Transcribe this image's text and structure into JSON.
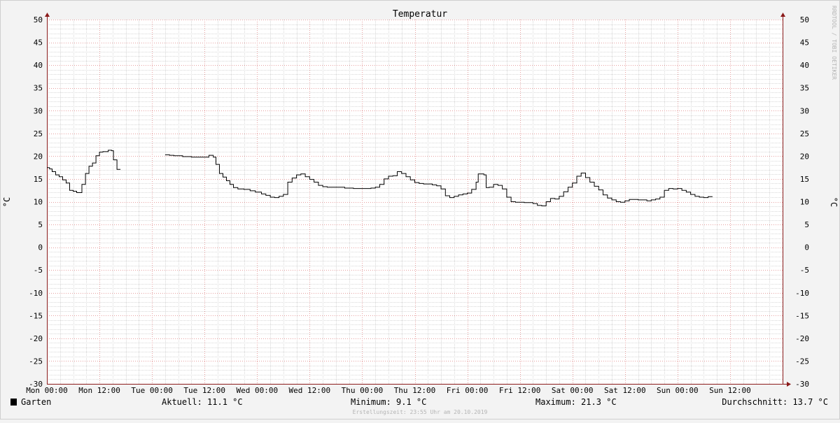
{
  "colors": {
    "background": "#f3f3f3",
    "canvas": "#ffffff",
    "grid_minor": "#d8d8d8",
    "grid_major": "#e6a0a0",
    "axis": "#8b1a1a",
    "line": "#000000",
    "text": "#000000",
    "watermark": "#b5b5b5"
  },
  "watermark": {
    "side_text": "RRDTOOL / TOBI OETIKER",
    "footer_text": "Erstellungszeit: 23:55 Uhr am 20.10.2019"
  },
  "legend": {
    "swatch_color": "#000000",
    "series_label": "Garten",
    "current": "Aktuell: 11.1 °C",
    "minimum": "Minimum: 9.1 °C",
    "maximum": "Maximum: 21.3 °C",
    "average": "Durchschnitt: 13.7 °C"
  },
  "chart_data": {
    "type": "line",
    "title": "Temperatur",
    "ylabel": "°C",
    "ylim": [
      -30,
      50
    ],
    "yticks": [
      50,
      45,
      40,
      35,
      30,
      25,
      20,
      15,
      10,
      5,
      0,
      -5,
      -10,
      -15,
      -20,
      -25,
      -30
    ],
    "x_unit": "hours since Mon 00:00",
    "xlim": [
      0,
      168
    ],
    "xticks": [
      {
        "x": 0,
        "label": "Mon 00:00"
      },
      {
        "x": 12,
        "label": "Mon 12:00"
      },
      {
        "x": 24,
        "label": "Tue 00:00"
      },
      {
        "x": 36,
        "label": "Tue 12:00"
      },
      {
        "x": 48,
        "label": "Wed 00:00"
      },
      {
        "x": 60,
        "label": "Wed 12:00"
      },
      {
        "x": 72,
        "label": "Thu 00:00"
      },
      {
        "x": 84,
        "label": "Thu 12:00"
      },
      {
        "x": 96,
        "label": "Fri 00:00"
      },
      {
        "x": 108,
        "label": "Fri 12:00"
      },
      {
        "x": 120,
        "label": "Sat 00:00"
      },
      {
        "x": 132,
        "label": "Sat 12:00"
      },
      {
        "x": 144,
        "label": "Sun 00:00"
      },
      {
        "x": 156,
        "label": "Sun 12:00"
      }
    ],
    "grid": true,
    "series": [
      {
        "name": "Garten",
        "segments": [
          [
            [
              0,
              17.5
            ],
            [
              0.6,
              17.2
            ],
            [
              1.2,
              16.6
            ],
            [
              2,
              15.9
            ],
            [
              2.8,
              15.5
            ],
            [
              3.6,
              14.8
            ],
            [
              4.4,
              14.1
            ],
            [
              5.2,
              12.5
            ],
            [
              6,
              12.3
            ],
            [
              6.8,
              12.0
            ],
            [
              8,
              13.8
            ],
            [
              8.8,
              16.2
            ],
            [
              9.6,
              17.8
            ],
            [
              10.4,
              18.5
            ],
            [
              11.2,
              20.1
            ],
            [
              12,
              20.9
            ],
            [
              12.8,
              21.0
            ],
            [
              14,
              21.3
            ],
            [
              14.8,
              21.2
            ],
            [
              15.2,
              19.2
            ],
            [
              16,
              17.1
            ],
            [
              16.8,
              17.1
            ]
          ],
          [
            [
              27,
              20.3
            ],
            [
              28,
              20.2
            ],
            [
              29,
              20.1
            ],
            [
              31,
              19.9
            ],
            [
              33,
              19.8
            ],
            [
              35,
              19.8
            ],
            [
              36,
              19.8
            ],
            [
              37,
              20.2
            ],
            [
              38,
              19.8
            ],
            [
              38.6,
              18.2
            ],
            [
              39.4,
              16.2
            ],
            [
              40.2,
              15.4
            ],
            [
              41,
              14.6
            ],
            [
              41.8,
              13.8
            ],
            [
              42.6,
              13.1
            ],
            [
              43.6,
              12.8
            ],
            [
              45,
              12.7
            ],
            [
              46.4,
              12.4
            ],
            [
              47.6,
              12.1
            ],
            [
              49,
              11.7
            ],
            [
              50,
              11.4
            ],
            [
              51,
              11.0
            ],
            [
              52,
              10.9
            ],
            [
              53,
              11.2
            ],
            [
              54,
              11.6
            ],
            [
              55,
              14.3
            ],
            [
              56,
              15.2
            ],
            [
              57,
              15.9
            ],
            [
              58,
              16.1
            ],
            [
              59,
              15.5
            ],
            [
              60,
              14.9
            ],
            [
              61,
              14.3
            ],
            [
              62,
              13.6
            ],
            [
              63,
              13.3
            ],
            [
              64,
              13.2
            ],
            [
              66,
              13.2
            ],
            [
              68,
              13.0
            ],
            [
              70,
              12.9
            ],
            [
              72,
              12.9
            ],
            [
              74,
              13.0
            ],
            [
              75,
              13.2
            ],
            [
              76,
              13.8
            ],
            [
              77,
              15.0
            ],
            [
              78,
              15.6
            ],
            [
              79,
              15.7
            ],
            [
              80,
              16.6
            ],
            [
              81,
              16.2
            ],
            [
              82,
              15.5
            ],
            [
              83,
              14.8
            ],
            [
              84,
              14.2
            ],
            [
              85,
              14.0
            ],
            [
              86,
              13.9
            ],
            [
              88,
              13.7
            ],
            [
              89,
              13.5
            ],
            [
              90,
              12.8
            ],
            [
              91,
              11.3
            ],
            [
              92,
              10.9
            ],
            [
              93,
              11.2
            ],
            [
              94,
              11.5
            ],
            [
              95,
              11.7
            ],
            [
              96,
              11.9
            ],
            [
              97,
              12.7
            ],
            [
              98,
              14.3
            ],
            [
              98.5,
              16.1
            ],
            [
              99.8,
              15.9
            ],
            [
              100.3,
              13.1
            ],
            [
              101,
              13.2
            ],
            [
              102,
              13.8
            ],
            [
              103,
              13.6
            ],
            [
              104,
              12.8
            ],
            [
              105,
              11.0
            ],
            [
              106,
              10.0
            ],
            [
              107,
              9.9
            ],
            [
              109,
              9.8
            ],
            [
              111,
              9.6
            ],
            [
              112,
              9.2
            ],
            [
              113,
              9.1
            ],
            [
              114,
              10.0
            ],
            [
              115,
              10.7
            ],
            [
              116,
              10.6
            ],
            [
              117,
              11.2
            ],
            [
              118,
              12.2
            ],
            [
              119,
              13.2
            ],
            [
              120,
              14.1
            ],
            [
              121,
              15.6
            ],
            [
              122,
              16.3
            ],
            [
              123,
              15.3
            ],
            [
              124,
              14.3
            ],
            [
              125,
              13.4
            ],
            [
              126,
              12.6
            ],
            [
              127,
              11.5
            ],
            [
              128,
              10.8
            ],
            [
              129,
              10.4
            ],
            [
              130,
              10.0
            ],
            [
              131,
              9.9
            ],
            [
              132,
              10.2
            ],
            [
              133,
              10.5
            ],
            [
              135,
              10.4
            ],
            [
              137,
              10.2
            ],
            [
              138,
              10.4
            ],
            [
              139,
              10.6
            ],
            [
              140,
              11.0
            ],
            [
              141,
              12.5
            ],
            [
              142,
              12.9
            ],
            [
              143,
              12.8
            ],
            [
              144,
              12.9
            ],
            [
              145,
              12.5
            ],
            [
              146,
              12.1
            ],
            [
              147,
              11.6
            ],
            [
              148,
              11.2
            ],
            [
              149,
              11.0
            ],
            [
              150,
              10.9
            ],
            [
              151,
              11.1
            ],
            [
              152,
              11.1
            ]
          ]
        ]
      }
    ]
  }
}
